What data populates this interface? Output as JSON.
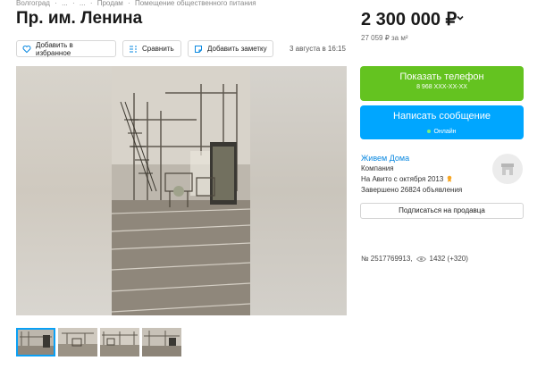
{
  "breadcrumbs": [
    "Волгоград",
    "·",
    "...",
    "·",
    "...",
    "·",
    "Продам",
    "·",
    "Помещение общественного питания"
  ],
  "listing": {
    "title": "Пр. им. Ленина",
    "price": "2 300 000 ₽",
    "price_per_m": "27 059 ₽ за м²",
    "date": "3 августа в 16:15"
  },
  "actions": {
    "favorite": "Добавить в избранное",
    "compare": "Сравнить",
    "note": "Добавить заметку"
  },
  "contact": {
    "phone_label": "Показать телефон",
    "phone_number": "8 968 XXX-XX-XX",
    "message_label": "Написать сообщение",
    "online_status": "Онлайн"
  },
  "seller": {
    "name": "Живем Дома",
    "type": "Компания",
    "since": "На Авито с октября 2013",
    "completed": "Завершено 26824 объявления",
    "subscribe_label": "Подписаться на продавца"
  },
  "stats": {
    "ad_number": "№ 2517769913,",
    "views": "1432 (+320)"
  },
  "colors": {
    "phone_button": "#64c320",
    "message_button": "#00a6ff",
    "link": "#0a88e0"
  }
}
